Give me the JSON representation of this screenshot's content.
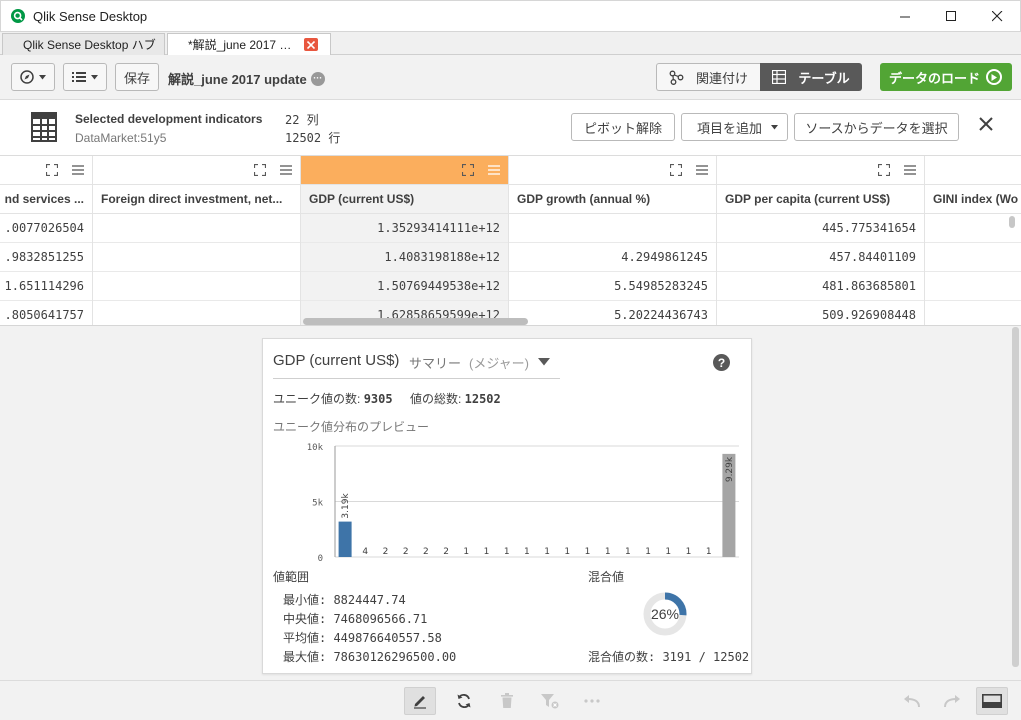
{
  "window": {
    "title": "Qlik Sense Desktop"
  },
  "tabs": [
    {
      "label": "Qlik Sense Desktop ハブ"
    },
    {
      "label": "*解説_june 2017 …"
    }
  ],
  "toolbar": {
    "save_label": "保存",
    "app_title": "解説_june 2017 update",
    "more_label": "···",
    "associations_label": "関連付け",
    "table_label": "テーブル",
    "load_label": "データのロード"
  },
  "info": {
    "table_name": "Selected development indicators",
    "source": "DataMarket:51y5",
    "columns": "22 列",
    "rows": "12502 行",
    "unpivot_label": "ピボット解除",
    "add_field_label": "項目を追加",
    "select_from_source_label": "ソースからデータを選択"
  },
  "grid": {
    "columns": [
      {
        "header": "nd services ...",
        "cells": [
          ".0077026504",
          ".9832851255",
          "1.651114296",
          ".8050641757"
        ]
      },
      {
        "header": "Foreign direct investment, net...",
        "cells": [
          "",
          "",
          "",
          ""
        ]
      },
      {
        "header": "GDP (current US$)",
        "cells": [
          "1.35293414111e+12",
          "1.4083198188e+12",
          "1.50769449538e+12",
          "1.62858659599e+12"
        ]
      },
      {
        "header": "GDP growth (annual %)",
        "cells": [
          "",
          "4.2949861245",
          "5.54985283245",
          "5.20224436743"
        ]
      },
      {
        "header": "GDP per capita (current US$)",
        "cells": [
          "445.775341654",
          "457.84401109",
          "481.863685801",
          "509.926908448"
        ]
      },
      {
        "header": "GINI index (Wo",
        "cells": [
          "",
          "",
          "",
          ""
        ]
      }
    ]
  },
  "summary": {
    "field_name": "GDP (current US$)",
    "label": "サマリー",
    "type": "(メジャー)",
    "unique_label": "ユニーク値の数:",
    "unique_value": "9305",
    "total_label": "値の総数:",
    "total_value": "12502",
    "preview_label": "ユニーク値分布のプレビュー",
    "range_title": "値範囲",
    "min": "最小値: 8824447.74",
    "median": "中央値: 7468096566.71",
    "mean": "平均値: 449876640557.58",
    "max": "最大値: 78630126296500.00",
    "mixed_title": "混合値",
    "mixed_percent": "26%",
    "mixed_fraction": 0.26,
    "mixed_count": "混合値の数: 3191 / 12502"
  },
  "chart_data": {
    "type": "bar",
    "title": "",
    "yticks": [
      "10k",
      "5k",
      "0"
    ],
    "ylim": [
      0,
      10000
    ],
    "values": [
      3190,
      4,
      2,
      2,
      2,
      2,
      1,
      1,
      1,
      1,
      1,
      1,
      1,
      1,
      1,
      1,
      1,
      1,
      1,
      9290
    ],
    "labels": [
      "3.19k",
      "4",
      "2",
      "2",
      "2",
      "2",
      "1",
      "1",
      "1",
      "1",
      "1",
      "1",
      "1",
      "1",
      "1",
      "1",
      "1",
      "1",
      "1",
      "9.29k"
    ],
    "colors": {
      "first": "#3e74a8",
      "last": "#a5a5a5",
      "grid": "#d9d9d9"
    }
  }
}
